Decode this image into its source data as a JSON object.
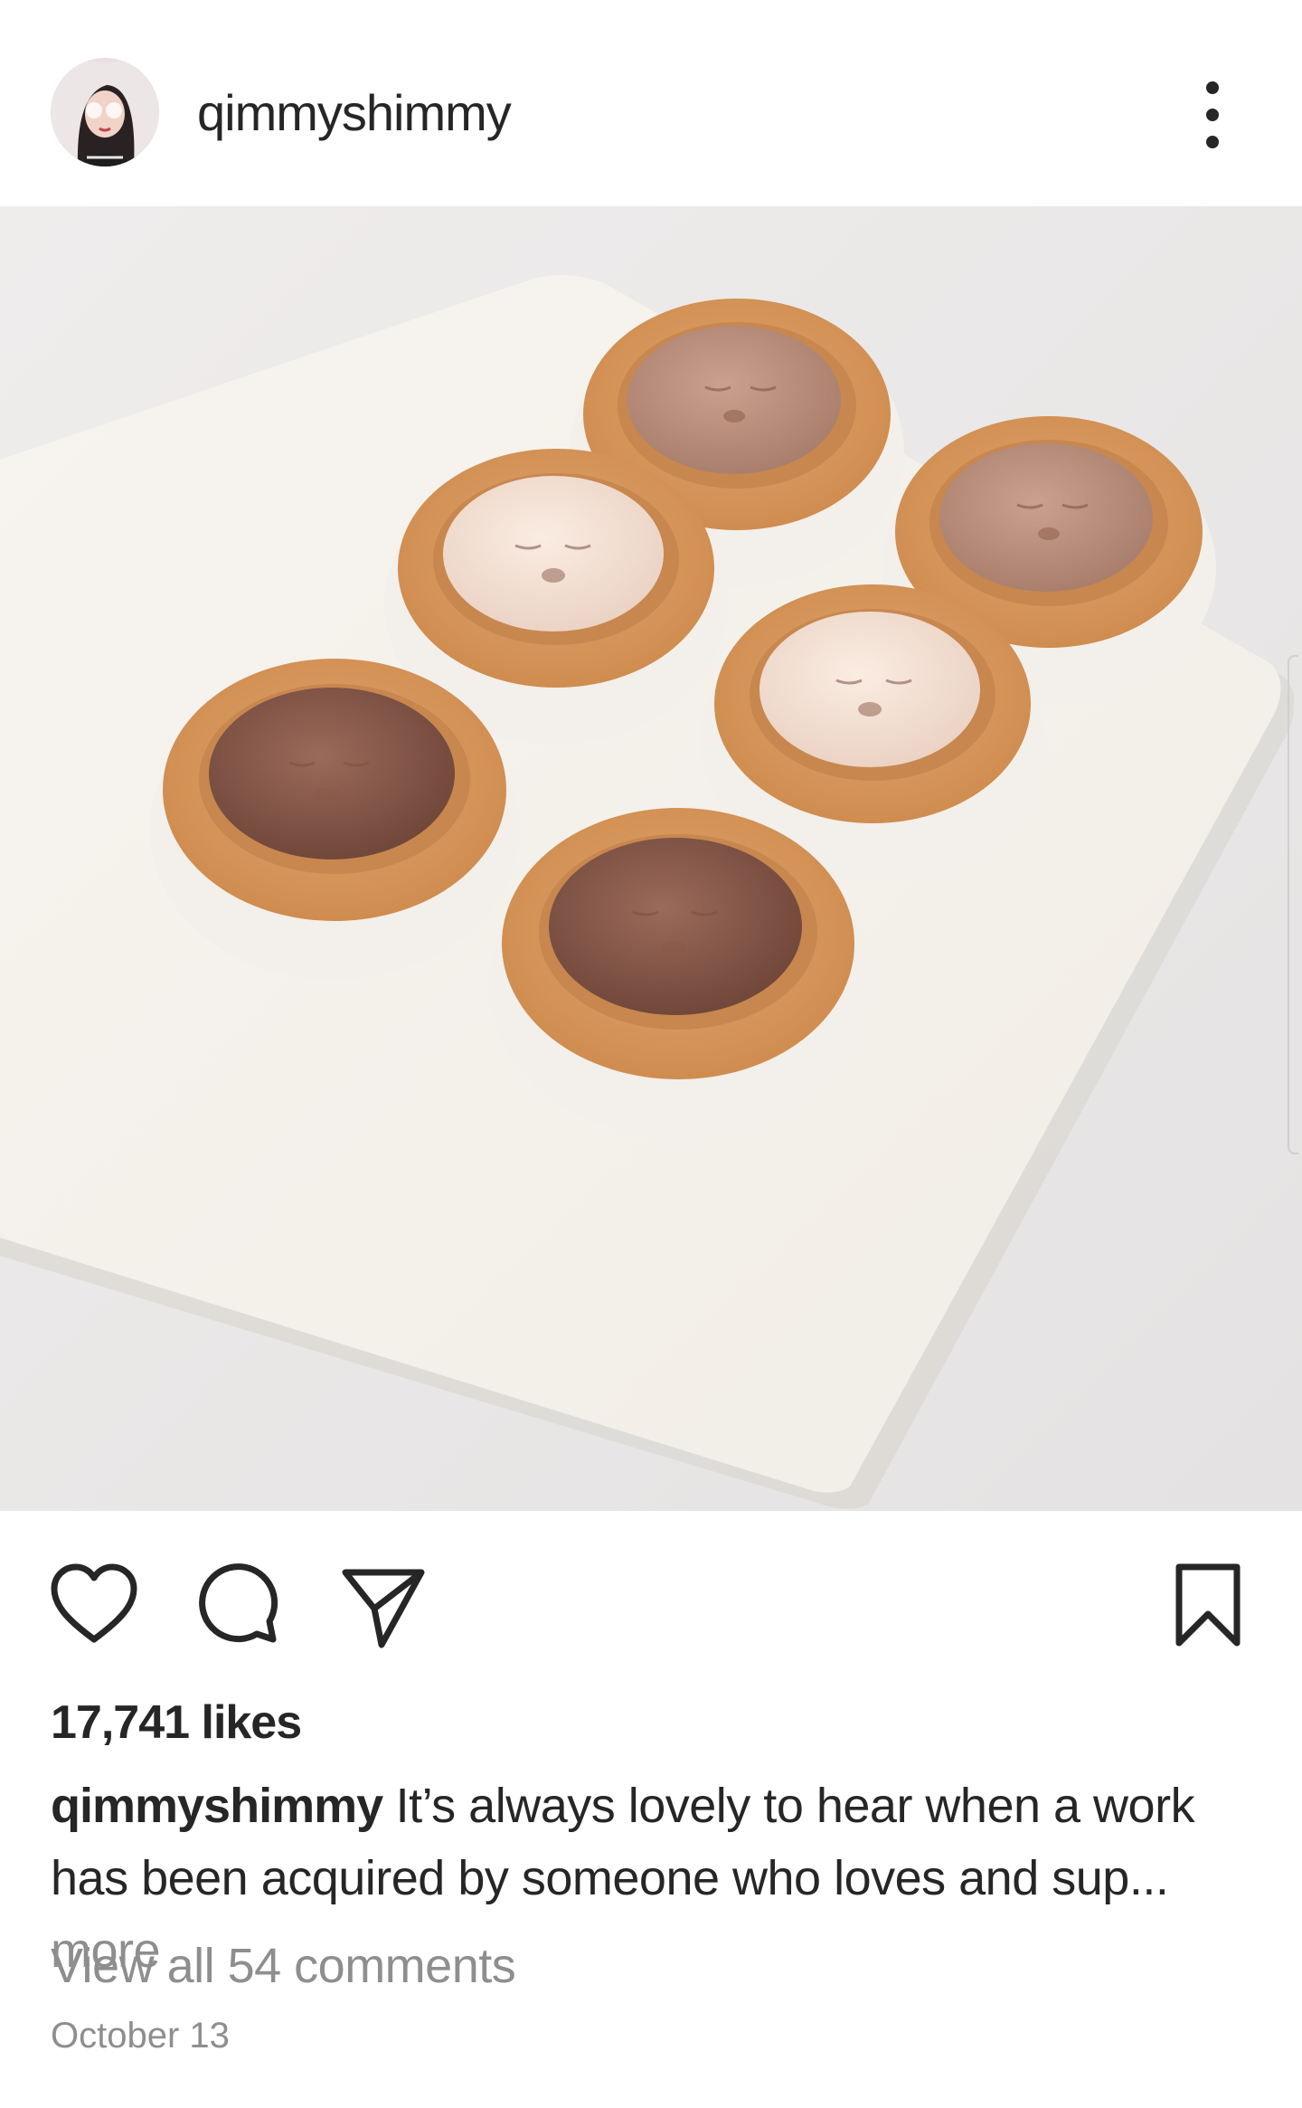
{
  "post": {
    "username": "qimmyshimmy",
    "likes": "17,741 likes",
    "caption_user": "qimmyshimmy",
    "caption_text": "It’s always lovely to hear when a work has been acquired by someone who loves and sup...",
    "more_label": "more",
    "view_comments": "View all 54 comments",
    "date": "October 13"
  },
  "icons": {
    "options": "more-vertical-icon",
    "like": "heart-icon",
    "comment": "comment-bubble-icon",
    "share": "send-paper-plane-icon",
    "save": "bookmark-icon"
  },
  "colors": {
    "text": "#262626",
    "muted": "#8e8e8e",
    "background": "#ffffff"
  }
}
